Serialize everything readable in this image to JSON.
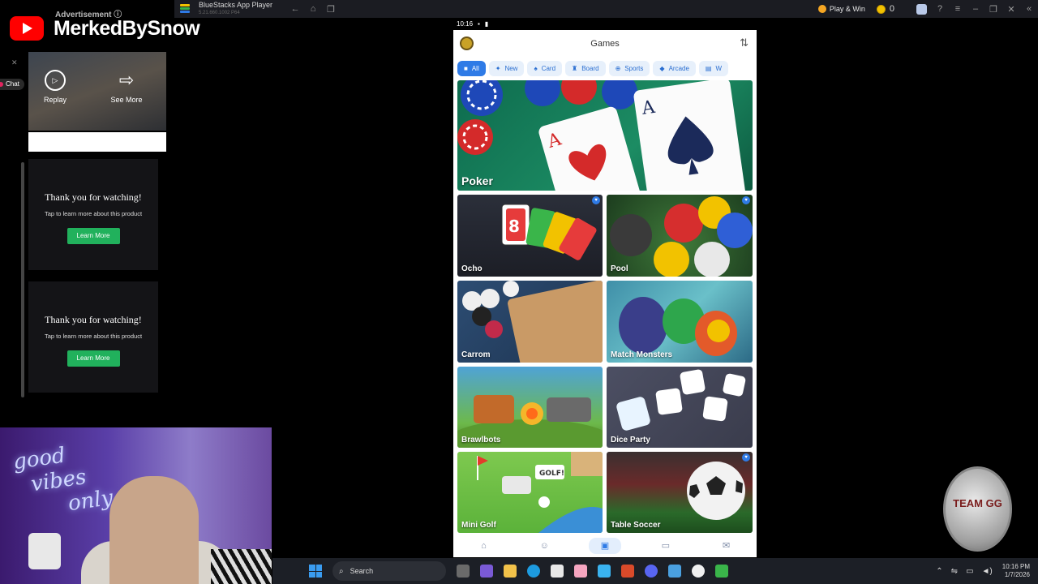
{
  "titlebar": {
    "app_name": "BlueStacks App Player",
    "app_subtitle": "5.21.660.1002 P64",
    "play_win": "Play & Win",
    "coins": "0"
  },
  "phone_status": {
    "time": "10:16"
  },
  "app": {
    "title": "Games",
    "filters": [
      {
        "label": "All",
        "icon": "gamepad-icon",
        "active": true
      },
      {
        "label": "New",
        "icon": "sparkle-icon"
      },
      {
        "label": "Card",
        "icon": "cards-icon"
      },
      {
        "label": "Board",
        "icon": "chess-icon"
      },
      {
        "label": "Sports",
        "icon": "ball-icon"
      },
      {
        "label": "Arcade",
        "icon": "arcade-icon"
      },
      {
        "label": "W",
        "icon": "book-icon"
      }
    ],
    "games": [
      {
        "name": "Poker",
        "favorite": false
      },
      {
        "name": "Ocho",
        "favorite": true
      },
      {
        "name": "Pool",
        "favorite": true
      },
      {
        "name": "Carrom",
        "favorite": false
      },
      {
        "name": "Match Monsters",
        "favorite": false
      },
      {
        "name": "Brawlbots",
        "favorite": false
      },
      {
        "name": "Dice Party",
        "favorite": false
      },
      {
        "name": "Mini Golf",
        "favorite": false
      },
      {
        "name": "Table Soccer",
        "favorite": true
      }
    ],
    "golf_sign": "GOLF!"
  },
  "overlay": {
    "channel": "MerkedBySnow",
    "ad_label": "Advertisement ⓘ",
    "replay": "Replay",
    "see_more": "See More",
    "chat": "Chat",
    "cards": [
      {
        "title": "Thank you for watching!",
        "subtitle": "Tap to learn more about this product",
        "button": "Learn More"
      },
      {
        "title": "Thank you for watching!",
        "subtitle": "Tap to learn more about this product",
        "button": "Learn More"
      }
    ]
  },
  "webcam": {
    "neon_line1": "good",
    "neon_line2": "vibes",
    "neon_line3": "only"
  },
  "gg_coin": {
    "text": "TEAM GG"
  },
  "taskbar": {
    "search_placeholder": "Search",
    "time": "10:16 PM",
    "date": "1/7/2026"
  },
  "colors": {
    "accent": "#2f7be6",
    "chip_bg": "#e7f0fb",
    "learn_more": "#21b15c"
  }
}
